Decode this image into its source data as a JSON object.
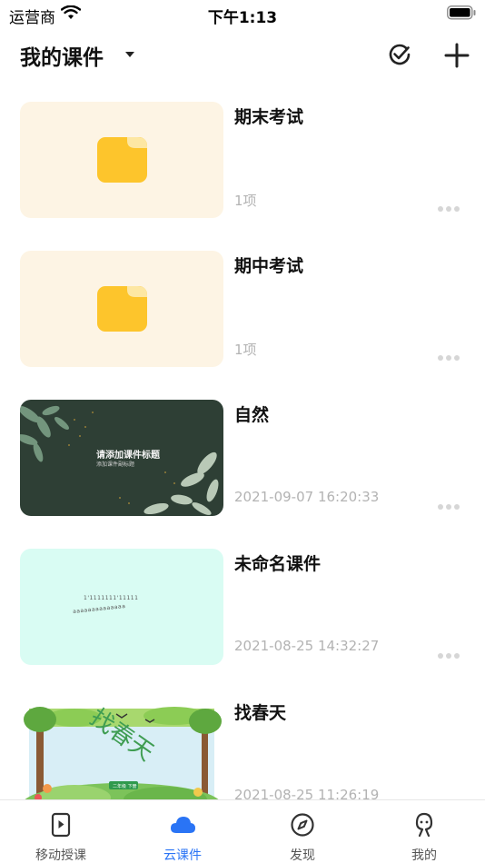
{
  "status_bar": {
    "carrier": "运营商",
    "time": "下午1:13"
  },
  "header": {
    "title": "我的课件"
  },
  "items": [
    {
      "name": "期末考试",
      "meta": "1项",
      "kind": "folder"
    },
    {
      "name": "期中考试",
      "meta": "1项",
      "kind": "folder"
    },
    {
      "name": "自然",
      "meta": "2021-09-07 16:20:33",
      "kind": "slide",
      "thumb_title": "请添加课件标题",
      "thumb_subtitle": "添加课件副标题"
    },
    {
      "name": "未命名课件",
      "meta": "2021-08-25 14:32:27",
      "kind": "slide",
      "thumb_line1": "1'1111111'11111",
      "thumb_line2": "aaaaaaaaaaaaaa"
    },
    {
      "name": "找春天",
      "meta": "2021-08-25 11:26:19",
      "kind": "slide",
      "thumb_title": "找春天",
      "thumb_badge": "二年级 下册"
    }
  ],
  "tabs": [
    {
      "label": "移动授课",
      "icon": "phone-play-icon",
      "active": false
    },
    {
      "label": "云课件",
      "icon": "cloud-icon",
      "active": true
    },
    {
      "label": "发现",
      "icon": "compass-icon",
      "active": false
    },
    {
      "label": "我的",
      "icon": "person-icon",
      "active": false
    }
  ],
  "colors": {
    "accent": "#2a74f5",
    "folder": "#fdc52c",
    "folder_bg": "#fdf4e4",
    "meta_text": "#b3b3b3"
  }
}
